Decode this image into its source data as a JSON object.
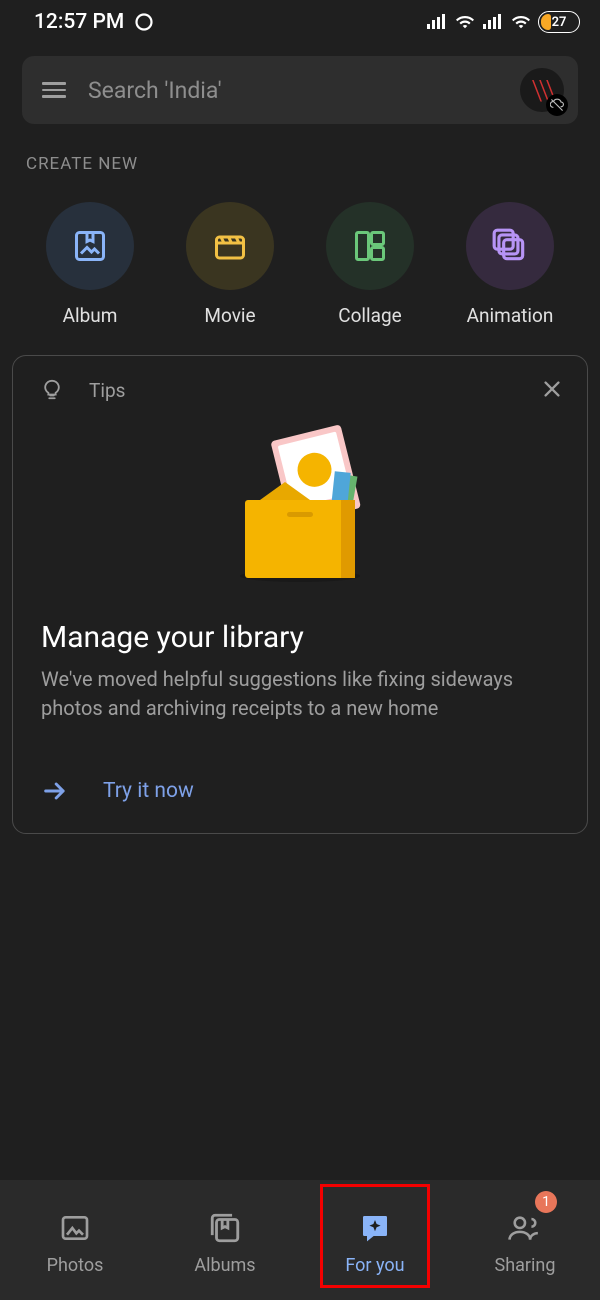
{
  "statusbar": {
    "time": "12:57 PM",
    "battery": "27"
  },
  "search": {
    "placeholder": "Search 'India'"
  },
  "section_label": "CREATE NEW",
  "create": {
    "album": "Album",
    "movie": "Movie",
    "collage": "Collage",
    "animation": "Animation"
  },
  "tips": {
    "header": "Tips",
    "title": "Manage your library",
    "body": "We've moved helpful suggestions like fixing sideways photos and archiving receipts to a new home",
    "cta": "Try it now"
  },
  "nav": {
    "photos": "Photos",
    "albums": "Albums",
    "foryou": "For you",
    "sharing": "Sharing",
    "sharing_badge": "1"
  }
}
